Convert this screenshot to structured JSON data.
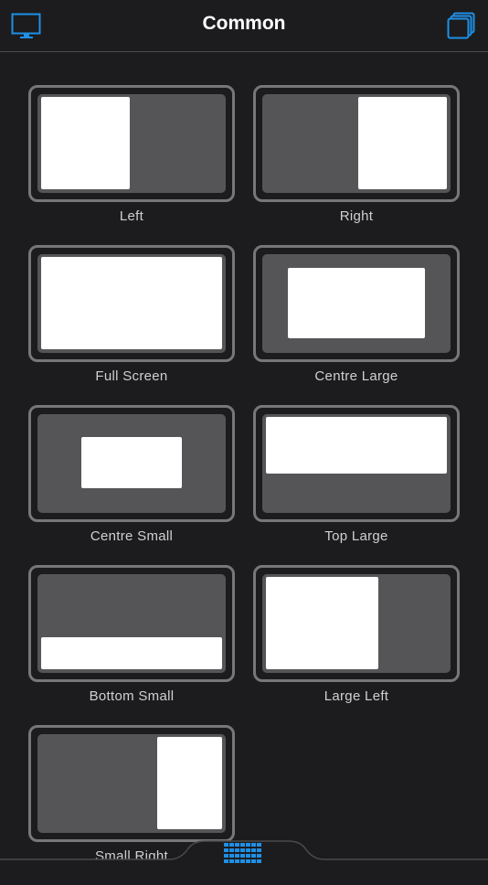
{
  "header": {
    "title": "Common",
    "display_icon": "monitor-icon",
    "pages_icon": "stacked-pages-icon",
    "accent_color": "#1e90e6"
  },
  "layouts": [
    {
      "label": "Left"
    },
    {
      "label": "Right"
    },
    {
      "label": "Full Screen"
    },
    {
      "label": "Centre Large"
    },
    {
      "label": "Centre Small"
    },
    {
      "label": "Top Large"
    },
    {
      "label": "Bottom Small"
    },
    {
      "label": "Large Left"
    },
    {
      "label": "Small Right"
    }
  ],
  "bottom_bar": {
    "grid_icon": "grid-icon"
  }
}
